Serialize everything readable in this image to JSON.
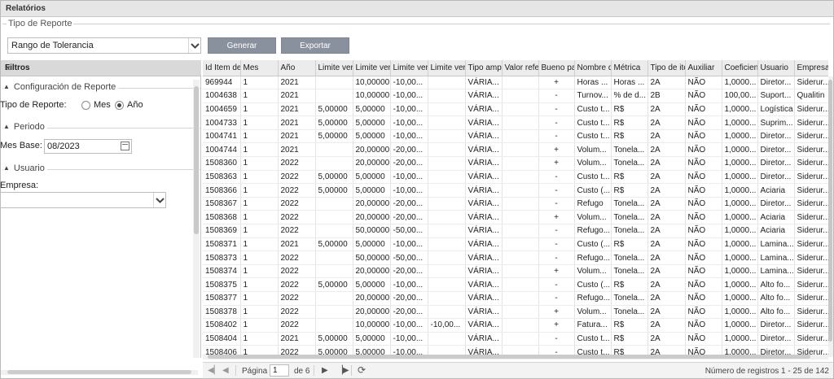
{
  "window": {
    "title": "Relatórios"
  },
  "report_type": {
    "legend": "Tipo de Reporte",
    "selected": "Rango de Tolerancia",
    "generate_label": "Generar",
    "export_label": "Exportar"
  },
  "filters": {
    "title": "Filtros",
    "collapse_icon": "«",
    "config_section": "Configuración de Reporte",
    "report_type_label": "Tipo de Reporte:",
    "option_month": "Mes",
    "option_year": "Año",
    "selected_option": "Año",
    "period_section": "Periodo",
    "base_month_label": "Mes Base:",
    "base_month_value": "08/2023",
    "user_section": "Usuario",
    "company_label": "Empresa:",
    "company_value": ""
  },
  "grid": {
    "columns": [
      "Id Item de",
      "Mes",
      "Año",
      "Limite verd",
      "Limite verd",
      "Limite verd",
      "Limite verd",
      "Tipo ampl",
      "Valor refer",
      "Bueno par",
      "Nombre d",
      "Métrica",
      "Tipo de ite",
      "Auxiliar",
      "Coeficient",
      "Usuario",
      "Empresa"
    ],
    "rows": [
      [
        "969944",
        "1",
        "2021",
        "",
        "10,00000",
        "-10,00...",
        "",
        "VÁRIA...",
        "",
        "+",
        "Horas ...",
        "Horas ...",
        "2A",
        "NÃO",
        "1,0000...",
        "Diretor...",
        "Siderur..."
      ],
      [
        "1004638",
        "1",
        "2021",
        "",
        "10,00000",
        "-10,00...",
        "",
        "VÁRIA...",
        "",
        "-",
        "Turnov...",
        "% de d...",
        "2B",
        "NÃO",
        "100,00...",
        "Suport...",
        "Qualitin"
      ],
      [
        "1004659",
        "1",
        "2021",
        "5,00000",
        "5,00000",
        "-10,00...",
        "",
        "VÁRIA...",
        "",
        "-",
        "Custo t...",
        "R$",
        "2A",
        "NÃO",
        "1,0000...",
        "Logística",
        "Siderur..."
      ],
      [
        "1004733",
        "1",
        "2021",
        "5,00000",
        "5,00000",
        "-10,00...",
        "",
        "VÁRIA...",
        "",
        "-",
        "Custo t...",
        "R$",
        "2A",
        "NÃO",
        "1,0000...",
        "Suprim...",
        "Siderur..."
      ],
      [
        "1004741",
        "1",
        "2021",
        "5,00000",
        "5,00000",
        "-10,00...",
        "",
        "VÁRIA...",
        "",
        "-",
        "Custo t...",
        "R$",
        "2A",
        "NÃO",
        "1,0000...",
        "Diretor...",
        "Siderur..."
      ],
      [
        "1004744",
        "1",
        "2021",
        "",
        "20,00000",
        "-20,00...",
        "",
        "VÁRIA...",
        "",
        "+",
        "Volum...",
        "Tonela...",
        "2A",
        "NÃO",
        "1,0000...",
        "Diretor...",
        "Siderur..."
      ],
      [
        "1508360",
        "1",
        "2022",
        "",
        "20,00000",
        "-20,00...",
        "",
        "VÁRIA...",
        "",
        "+",
        "Volum...",
        "Tonela...",
        "2A",
        "NÃO",
        "1,0000...",
        "Diretor...",
        "Siderur..."
      ],
      [
        "1508363",
        "1",
        "2022",
        "5,00000",
        "5,00000",
        "-10,00...",
        "",
        "VÁRIA...",
        "",
        "-",
        "Custo t...",
        "R$",
        "2A",
        "NÃO",
        "1,0000...",
        "Diretor...",
        "Siderur..."
      ],
      [
        "1508366",
        "1",
        "2022",
        "5,00000",
        "5,00000",
        "-10,00...",
        "",
        "VÁRIA...",
        "",
        "-",
        "Custo (...",
        "R$",
        "2A",
        "NÃO",
        "1,0000...",
        "Aciaria",
        "Siderur..."
      ],
      [
        "1508367",
        "1",
        "2022",
        "",
        "20,00000",
        "-20,00...",
        "",
        "VÁRIA...",
        "",
        "-",
        "Refugo",
        "Tonela...",
        "2A",
        "NÃO",
        "1,0000...",
        "Diretor...",
        "Siderur..."
      ],
      [
        "1508368",
        "1",
        "2022",
        "",
        "20,00000",
        "-20,00...",
        "",
        "VÁRIA...",
        "",
        "+",
        "Volum...",
        "Tonela...",
        "2A",
        "NÃO",
        "1,0000...",
        "Aciaria",
        "Siderur..."
      ],
      [
        "1508369",
        "1",
        "2022",
        "",
        "50,00000",
        "-50,00...",
        "",
        "VÁRIA...",
        "",
        "-",
        "Refugo...",
        "Tonela...",
        "2A",
        "NÃO",
        "1,0000...",
        "Aciaria",
        "Siderur..."
      ],
      [
        "1508371",
        "1",
        "2021",
        "5,00000",
        "5,00000",
        "-10,00...",
        "",
        "VÁRIA...",
        "",
        "-",
        "Custo (...",
        "R$",
        "2A",
        "NÃO",
        "1,0000...",
        "Lamina...",
        "Siderur..."
      ],
      [
        "1508373",
        "1",
        "2022",
        "",
        "50,00000",
        "-50,00...",
        "",
        "VÁRIA...",
        "",
        "-",
        "Refugo...",
        "Tonela...",
        "2A",
        "NÃO",
        "1,0000...",
        "Lamina...",
        "Siderur..."
      ],
      [
        "1508374",
        "1",
        "2022",
        "",
        "20,00000",
        "-20,00...",
        "",
        "VÁRIA...",
        "",
        "+",
        "Volum...",
        "Tonela...",
        "2A",
        "NÃO",
        "1,0000...",
        "Lamina...",
        "Siderur..."
      ],
      [
        "1508375",
        "1",
        "2022",
        "5,00000",
        "5,00000",
        "-10,00...",
        "",
        "VÁRIA...",
        "",
        "-",
        "Custo (...",
        "R$",
        "2A",
        "NÃO",
        "1,0000...",
        "Alto fo...",
        "Siderur..."
      ],
      [
        "1508377",
        "1",
        "2022",
        "",
        "20,00000",
        "-20,00...",
        "",
        "VÁRIA...",
        "",
        "-",
        "Refugo...",
        "Tonela...",
        "2A",
        "NÃO",
        "1,0000...",
        "Alto fo...",
        "Siderur..."
      ],
      [
        "1508378",
        "1",
        "2022",
        "",
        "20,00000",
        "-20,00...",
        "",
        "VÁRIA...",
        "",
        "+",
        "Volum...",
        "Tonela...",
        "2A",
        "NÃO",
        "1,0000...",
        "Alto fo...",
        "Siderur..."
      ],
      [
        "1508402",
        "1",
        "2022",
        "",
        "10,00000",
        "-10,00...",
        "-10,00...",
        "VÁRIA...",
        "",
        "+",
        "Fatura...",
        "R$",
        "2A",
        "NÃO",
        "1,0000...",
        "Diretor...",
        "Siderur..."
      ],
      [
        "1508404",
        "1",
        "2021",
        "5,00000",
        "5,00000",
        "-10,00...",
        "",
        "VÁRIA...",
        "",
        "-",
        "Custo t...",
        "R$",
        "2A",
        "NÃO",
        "1,0000...",
        "Diretor...",
        "Siderur..."
      ],
      [
        "1508406",
        "1",
        "2022",
        "5,00000",
        "5,00000",
        "-10,00...",
        "",
        "VÁRIA...",
        "",
        "-",
        "Custo t...",
        "R$",
        "2A",
        "NÃO",
        "1,0000...",
        "Diretor...",
        "Siderur..."
      ]
    ]
  },
  "pager": {
    "page_label": "Página",
    "page_value": "1",
    "of_label": "de 6",
    "summary": "Número de registros 1 - 25 de 142"
  }
}
